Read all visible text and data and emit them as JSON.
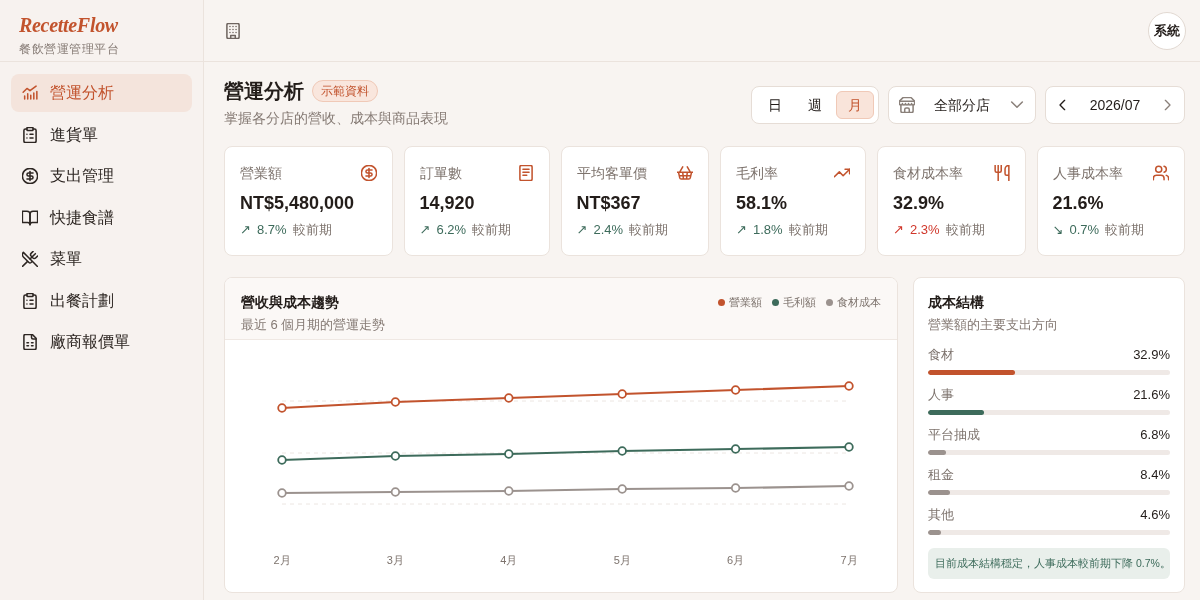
{
  "app": {
    "logo": "RecetteFlow",
    "tagline": "餐飲營運管理平台"
  },
  "sidebar": {
    "items": [
      {
        "label": "營運分析",
        "selected": true
      },
      {
        "label": "進貨單",
        "selected": false
      },
      {
        "label": "支出管理",
        "selected": false
      },
      {
        "label": "快捷食譜",
        "selected": false
      },
      {
        "label": "菜單",
        "selected": false
      },
      {
        "label": "出餐計劃",
        "selected": false
      },
      {
        "label": "廠商報價單",
        "selected": false
      }
    ]
  },
  "topbar": {
    "account": "系統"
  },
  "page": {
    "title": "營運分析",
    "badge": "示範資料",
    "subtitle": "掌握各分店的營收、成本與商品表現"
  },
  "period_tabs": [
    {
      "label": "日",
      "selected": false
    },
    {
      "label": "週",
      "selected": false
    },
    {
      "label": "月",
      "selected": true
    }
  ],
  "branch_select": {
    "value": "全部分店"
  },
  "month_nav": {
    "value": "2026/07"
  },
  "kpis": [
    {
      "label": "營業額",
      "value": "NT$5,480,000",
      "trend_icon": "↗",
      "change": "8.7%",
      "comparison": "較前期",
      "favorable": true
    },
    {
      "label": "訂單數",
      "value": "14,920",
      "trend_icon": "↗",
      "change": "6.2%",
      "comparison": "較前期",
      "favorable": true
    },
    {
      "label": "平均客單價",
      "value": "NT$367",
      "trend_icon": "↗",
      "change": "2.4%",
      "comparison": "較前期",
      "favorable": true
    },
    {
      "label": "毛利率",
      "value": "58.1%",
      "trend_icon": "↗",
      "change": "1.8%",
      "comparison": "較前期",
      "favorable": true
    },
    {
      "label": "食材成本率",
      "value": "32.9%",
      "trend_icon": "↗",
      "change": "2.3%",
      "comparison": "較前期",
      "favorable": false
    },
    {
      "label": "人事成本率",
      "value": "21.6%",
      "trend_icon": "↘",
      "change": "0.7%",
      "comparison": "較前期",
      "favorable": true
    }
  ],
  "trend_chart": {
    "title": "營收與成本趨勢",
    "subtitle": "最近 6 個月期的營運走勢",
    "legend": [
      {
        "label": "營業額",
        "color": "#c2532d"
      },
      {
        "label": "毛利額",
        "color": "#3d6b5b"
      },
      {
        "label": "食材成本",
        "color": "#9b928e"
      }
    ],
    "x_labels": [
      "2月",
      "3月",
      "4月",
      "5月",
      "6月",
      "7月"
    ]
  },
  "cost_structure": {
    "title": "成本結構",
    "subtitle": "營業額的主要支出方向",
    "items": [
      {
        "label": "食材",
        "value": "32.9%",
        "level": 0.36,
        "color": "#c2532d"
      },
      {
        "label": "人事",
        "value": "21.6%",
        "level": 0.233,
        "color": "#3d6b5b"
      },
      {
        "label": "平台抽成",
        "value": "6.8%",
        "level": 0.073,
        "color": "#9b928e"
      },
      {
        "label": "租金",
        "value": "8.4%",
        "level": 0.09,
        "color": "#9b928e"
      },
      {
        "label": "其他",
        "value": "4.6%",
        "level": 0.052,
        "color": "#9b928e"
      }
    ],
    "note": "目前成本結構穩定，人事成本較前期下降 0.7%。"
  }
}
